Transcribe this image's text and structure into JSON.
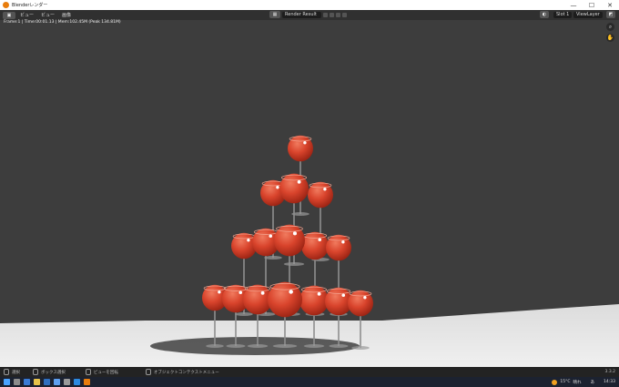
{
  "window": {
    "title": "Blenderレンダー",
    "controls": {
      "minimize": "—",
      "maximize": "☐",
      "close": "✕"
    }
  },
  "header": {
    "editor_icon": "image-editor-icon",
    "menu": [
      "ビュー",
      "ビュー",
      "画像"
    ],
    "image_name": "Render Result",
    "slot": "Slot 1",
    "view_layer": "ViewLayer"
  },
  "info": {
    "text": "Frame:1 | Time:00:01.13 | Mem:102.45M (Peak 134.81M)"
  },
  "statusbar": {
    "items": [
      "選択",
      "ボックス選択",
      "ビューを回転",
      "オブジェクトコンテクストメニュー"
    ],
    "version": "3.3.2"
  },
  "taskbar": {
    "weather": "15°C",
    "weather_desc": "晴れ",
    "ime": "あ",
    "time": "14:33"
  },
  "colors": {
    "viewport_bg": "#3d3d3d",
    "floor": "#e6e6e6",
    "glass_red": "#d9442c",
    "accent": "#e87d0d"
  }
}
